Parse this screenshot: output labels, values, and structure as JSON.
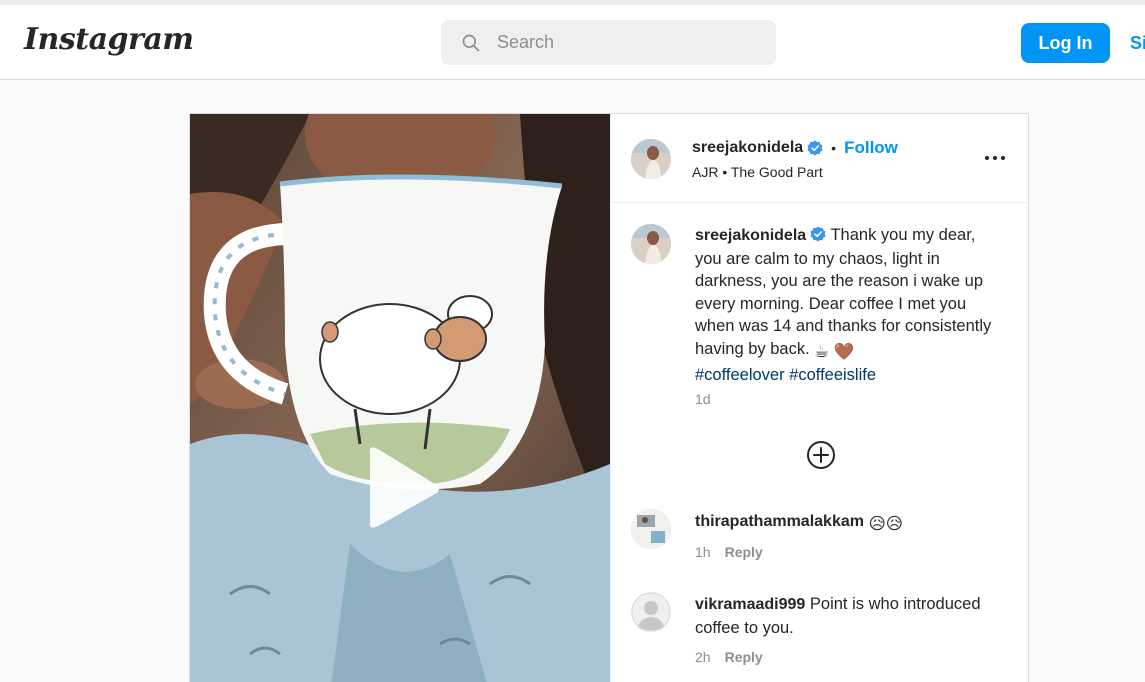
{
  "header": {
    "logo": "Instagram",
    "search_placeholder": "Search",
    "login_label": "Log In",
    "signup_label": "Si"
  },
  "post": {
    "username": "sreejakonidela",
    "follow_label": "Follow",
    "dot": "•",
    "audio": "AJR • The Good Part",
    "caption": {
      "username": "sreejakonidela",
      "text": "Thank you my dear, you are calm to my chaos, light in darkness, you are the reason i wake up every morning. Dear coffee I met you when was 14 and thanks for consistently having by back.",
      "emojis": "☕ 🤎",
      "hashtag1": "#coffeelover",
      "hashtag2": "#coffeeislife",
      "time": "1d"
    },
    "comments": [
      {
        "username": "thirapathammalakkam",
        "text": "😥😥",
        "time": "1h",
        "reply_label": "Reply"
      },
      {
        "username": "vikramaadi999",
        "text": "Point is who introduced coffee to you.",
        "time": "2h",
        "reply_label": "Reply"
      }
    ]
  },
  "colors": {
    "accent": "#0095f6",
    "hashtag": "#00376b",
    "muted": "#8e8e8e"
  },
  "icons": [
    "search-icon",
    "verified-badge-icon",
    "more-options-icon",
    "play-icon",
    "load-more-comments-icon",
    "default-avatar-icon"
  ]
}
